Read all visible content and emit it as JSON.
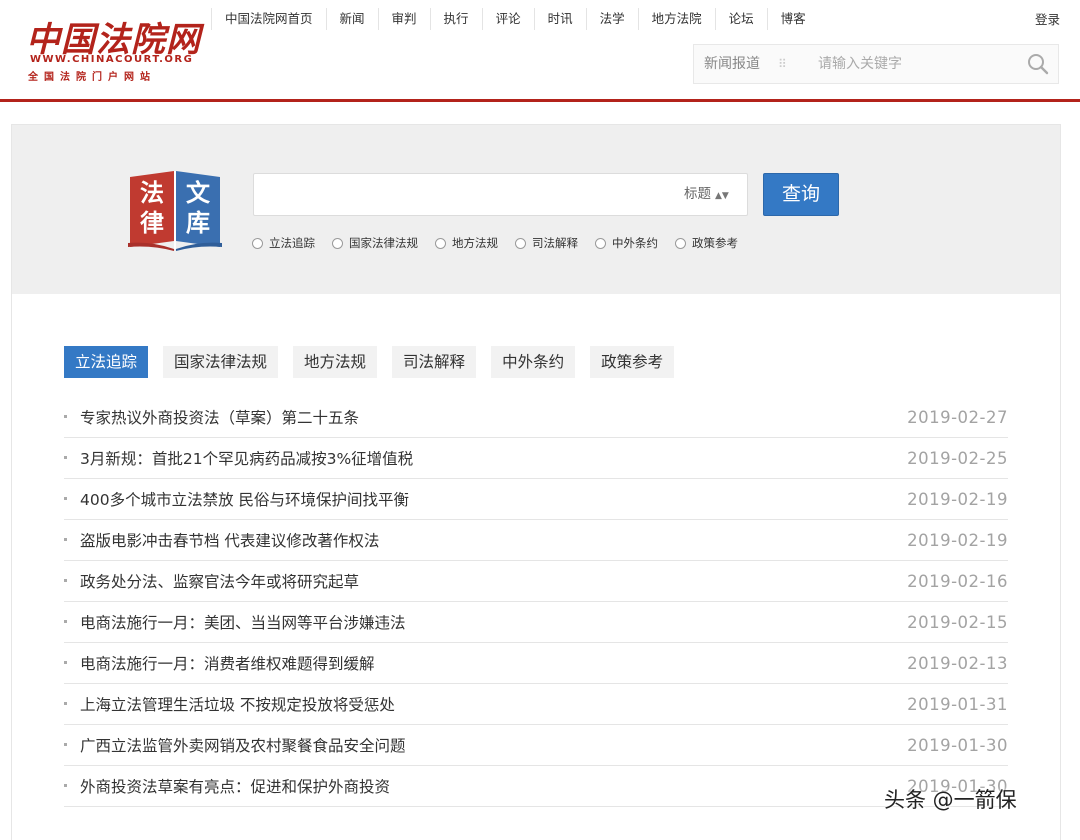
{
  "header": {
    "logo": {
      "main_text": "中国法院网",
      "url_text": "WWW.CHINACOURT.ORG",
      "sub_text": "全国法院门户网站"
    },
    "nav": [
      "中国法院网首页",
      "新闻",
      "审判",
      "执行",
      "评论",
      "时讯",
      "法学",
      "地方法院",
      "论坛",
      "博客"
    ],
    "login_label": "登录",
    "search": {
      "category": "新闻报道",
      "separator": "⠿",
      "placeholder": "请输入关键字",
      "icon": "search-icon"
    },
    "accent_color": "#b3231b"
  },
  "library": {
    "logo_chars": [
      "法",
      "律",
      "文",
      "库"
    ],
    "query_placeholder": "",
    "field_select": "标题",
    "query_button": "查询",
    "radio_options": [
      "立法追踪",
      "国家法律法规",
      "地方法规",
      "司法解释",
      "中外条约",
      "政策参考"
    ],
    "button_color": "#3479c5"
  },
  "tabs": {
    "items": [
      "立法追踪",
      "国家法律法规",
      "地方法规",
      "司法解释",
      "中外条约",
      "政策参考"
    ],
    "active": "立法追踪"
  },
  "news": [
    {
      "title": "专家热议外商投资法（草案）第二十五条",
      "date": "2019-02-27"
    },
    {
      "title": "3月新规：首批21个罕见病药品减按3%征增值税",
      "date": "2019-02-25"
    },
    {
      "title": "400多个城市立法禁放 民俗与环境保护间找平衡",
      "date": "2019-02-19"
    },
    {
      "title": "盗版电影冲击春节档 代表建议修改著作权法",
      "date": "2019-02-19"
    },
    {
      "title": "政务处分法、监察官法今年或将研究起草",
      "date": "2019-02-16"
    },
    {
      "title": "电商法施行一月：美团、当当网等平台涉嫌违法",
      "date": "2019-02-15"
    },
    {
      "title": "电商法施行一月：消费者维权难题得到缓解",
      "date": "2019-02-13"
    },
    {
      "title": "上海立法管理生活垃圾 不按规定投放将受惩处",
      "date": "2019-01-31"
    },
    {
      "title": "广西立法监管外卖网销及农村聚餐食品安全问题",
      "date": "2019-01-30"
    },
    {
      "title": "外商投资法草案有亮点：促进和保护外商投资",
      "date": "2019-01-30"
    }
  ],
  "watermark": "头条 @一箭保"
}
